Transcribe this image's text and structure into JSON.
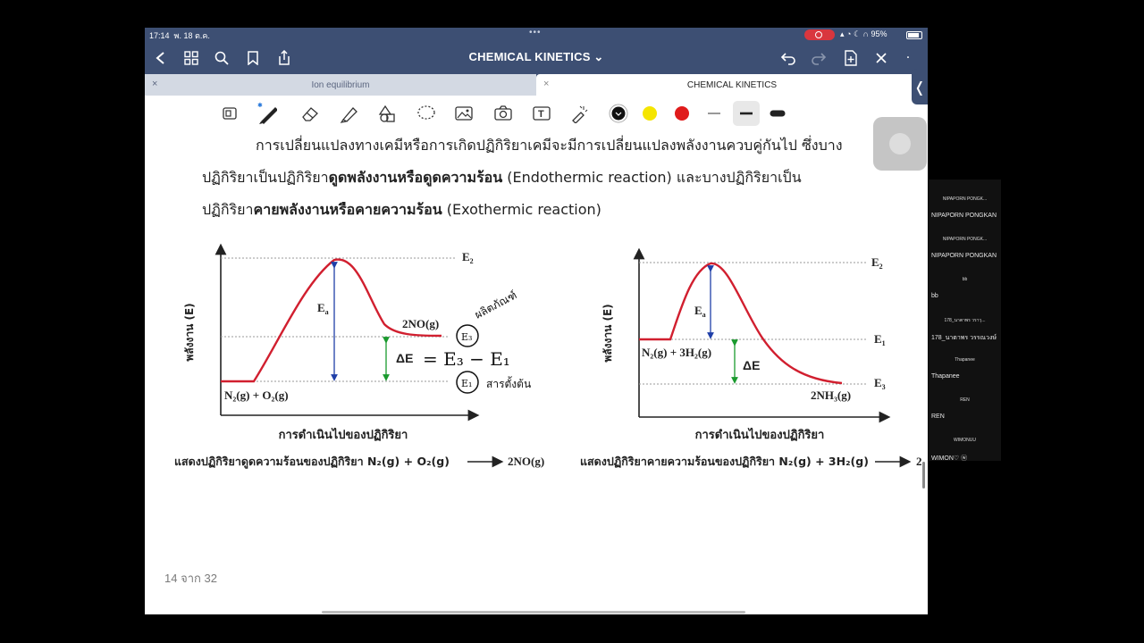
{
  "status": {
    "time": "17:14",
    "date": "พ. 18 ต.ค.",
    "battery": "95%"
  },
  "nav": {
    "title": "CHEMICAL KINETICS ⌄"
  },
  "tabs": [
    {
      "label": "Ion equilibrium",
      "active": false
    },
    {
      "label": "CHEMICAL KINETICS",
      "active": true
    }
  ],
  "toolbar": {
    "tools": [
      "page-icon",
      "pen-icon",
      "eraser-icon",
      "highlighter-icon",
      "shapes-icon",
      "lasso-icon",
      "image-icon",
      "camera-icon",
      "text-icon",
      "laser-icon"
    ],
    "colors": [
      "#111111",
      "#f5e500",
      "#e01b1b"
    ]
  },
  "document": {
    "line1": "การเปลี่ยนแปลงทางเคมีหรือการเกิดปฏิกิริยาเคมีจะมีการเปลี่ยนแปลงพลังงานควบคู่กันไป ซึ่งบาง",
    "line2_pre": "ปฏิกิริยาเป็นปฏิกิริยา",
    "line2_bold": "ดูดพลังงานหรือดูดความร้อน",
    "line2_post": " (Endothermic reaction) และบางปฏิกิริยาเป็น",
    "line3_pre": "ปฏิกิริยา",
    "line3_bold": "คายพลังงานหรือคายความร้อน",
    "line3_post": " (Exothermic reaction)",
    "page_counter": "14 จาก 32"
  },
  "diagram_left": {
    "ylabel": "พลังงาน (E)",
    "xlabel": "การดำเนินไปของปฏิกิริยา",
    "E2": "E",
    "E2sub": "2",
    "Ea": "E",
    "Easub": "a",
    "product": "2NO(g)",
    "reactant": "N₂(g) + O₂(g)",
    "dE": "ΔE",
    "caption": "แสดงปฏิกิริยาดูดความร้อนของปฏิกิริยา N₂(g) + O₂(g)",
    "caption_product": "2NO(g)",
    "hand_eq": "= E₃ − E₁",
    "hand_top": "ผลิตภัณฑ์",
    "hand_bottom": "สารตั้งต้น"
  },
  "diagram_right": {
    "ylabel": "พลังงาน (E)",
    "xlabel": "การดำเนินไปของปฏิกิริยา",
    "E2": "E",
    "E2sub": "2",
    "E1": "E",
    "E1sub": "1",
    "E3": "E",
    "E3sub": "3",
    "Ea": "E",
    "Easub": "a",
    "reactant": "N₂(g) + 3H₂(g)",
    "product": "2NH₃(g)",
    "dE": "ΔE",
    "caption": "แสดงปฏิกิริยาคายความร้อนของปฏิกิริยา N₂(g) + 3H₂(g)",
    "caption_product": "2"
  },
  "participants": [
    {
      "small": "NIPAPORN PONGK...",
      "name": "NIPAPORN PONGKAN"
    },
    {
      "small": "NIPAPORN PONGK...",
      "name": "NIPAPORN PONGKAN"
    },
    {
      "small": "bb",
      "name": "bb"
    },
    {
      "small": "178_นาตาพร วราวุ...",
      "name": "178_นาตาพร วรรณวงษ์"
    },
    {
      "small": "Thapanee",
      "name": "Thapanee"
    },
    {
      "small": "REN",
      "name": "REN"
    },
    {
      "small": "WIMONUU",
      "name": "WIMON♡ ⓦ"
    }
  ]
}
